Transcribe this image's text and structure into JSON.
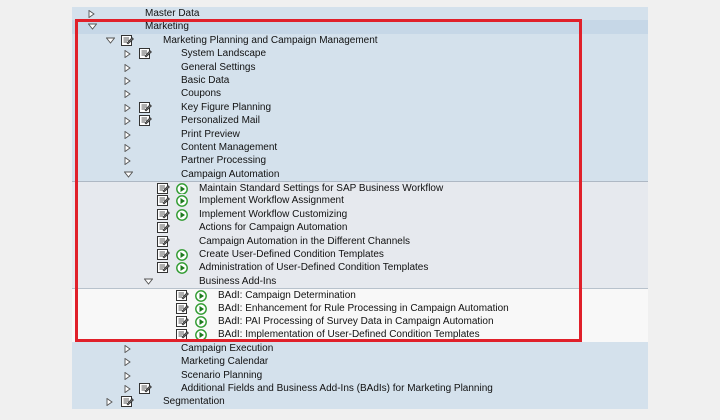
{
  "tree": [
    {
      "label": "Master Data",
      "level": 0,
      "toggle": "collapsed",
      "icon": "",
      "section": "blue"
    },
    {
      "label": "Marketing",
      "level": 0,
      "toggle": "expanded",
      "icon": "",
      "section": "sel"
    },
    {
      "label": "Marketing Planning and Campaign Management",
      "level": 1,
      "toggle": "expanded",
      "icon": "doc",
      "section": "blue"
    },
    {
      "label": "System Landscape",
      "level": 2,
      "toggle": "collapsed",
      "icon": "doc",
      "section": "blue"
    },
    {
      "label": "General Settings",
      "level": 2,
      "toggle": "collapsed",
      "icon": "",
      "section": "blue"
    },
    {
      "label": "Basic Data",
      "level": 2,
      "toggle": "collapsed",
      "icon": "",
      "section": "blue"
    },
    {
      "label": "Coupons",
      "level": 2,
      "toggle": "collapsed",
      "icon": "",
      "section": "blue"
    },
    {
      "label": "Key Figure Planning",
      "level": 2,
      "toggle": "collapsed",
      "icon": "doc",
      "section": "blue"
    },
    {
      "label": "Personalized Mail",
      "level": 2,
      "toggle": "collapsed",
      "icon": "doc",
      "section": "blue"
    },
    {
      "label": "Print Preview",
      "level": 2,
      "toggle": "collapsed",
      "icon": "",
      "section": "blue"
    },
    {
      "label": "Content Management",
      "level": 2,
      "toggle": "collapsed",
      "icon": "",
      "section": "blue"
    },
    {
      "label": "Partner Processing",
      "level": 2,
      "toggle": "collapsed",
      "icon": "",
      "section": "blue"
    },
    {
      "label": "Campaign Automation",
      "level": 2,
      "toggle": "expanded",
      "icon": "",
      "section": "blue"
    },
    {
      "label": "Maintain Standard Settings for SAP Business Workflow",
      "level": 3,
      "toggle": "",
      "icon": "doc-exec",
      "section": "grey"
    },
    {
      "label": "Implement Workflow Assignment",
      "level": 3,
      "toggle": "",
      "icon": "doc-exec",
      "section": "grey"
    },
    {
      "label": "Implement Workflow Customizing",
      "level": 3,
      "toggle": "",
      "icon": "doc-exec",
      "section": "grey"
    },
    {
      "label": "Actions for Campaign Automation",
      "level": 3,
      "toggle": "",
      "icon": "doc",
      "section": "grey"
    },
    {
      "label": "Campaign Automation in the Different Channels",
      "level": 3,
      "toggle": "",
      "icon": "doc",
      "section": "grey"
    },
    {
      "label": "Create User-Defined Condition Templates",
      "level": 3,
      "toggle": "",
      "icon": "doc-exec",
      "section": "grey"
    },
    {
      "label": "Administration of User-Defined Condition Templates",
      "level": 3,
      "toggle": "",
      "icon": "doc-exec",
      "section": "grey"
    },
    {
      "label": "Business Add-Ins",
      "level": 3,
      "toggle": "expanded",
      "icon": "",
      "section": "grey"
    },
    {
      "label": "BAdI: Campaign Determination",
      "level": 4,
      "toggle": "",
      "icon": "doc-exec",
      "section": "white"
    },
    {
      "label": "BAdI: Enhancement for Rule Processing in Campaign Automation",
      "level": 4,
      "toggle": "",
      "icon": "doc-exec",
      "section": "white"
    },
    {
      "label": "BAdI: PAI Processing of Survey Data in Campaign Automation",
      "level": 4,
      "toggle": "",
      "icon": "doc-exec",
      "section": "white"
    },
    {
      "label": "BAdI: Implementation of User-Defined Condition Templates",
      "level": 4,
      "toggle": "",
      "icon": "doc-exec",
      "section": "white"
    },
    {
      "label": "Campaign Execution",
      "level": 2,
      "toggle": "collapsed",
      "icon": "",
      "section": "blue"
    },
    {
      "label": "Marketing Calendar",
      "level": 2,
      "toggle": "collapsed",
      "icon": "",
      "section": "blue"
    },
    {
      "label": "Scenario Planning",
      "level": 2,
      "toggle": "collapsed",
      "icon": "",
      "section": "blue"
    },
    {
      "label": "Additional Fields and Business Add-Ins (BAdIs) for Marketing Planning",
      "level": 2,
      "toggle": "collapsed",
      "icon": "doc",
      "section": "blue"
    },
    {
      "label": "Segmentation",
      "level": 1,
      "toggle": "collapsed",
      "icon": "doc",
      "section": "blue"
    }
  ],
  "colors": {
    "highlight": "#e0202a",
    "tree_bg": "#d4e1ec",
    "exec_green": "#2e9a2e"
  }
}
